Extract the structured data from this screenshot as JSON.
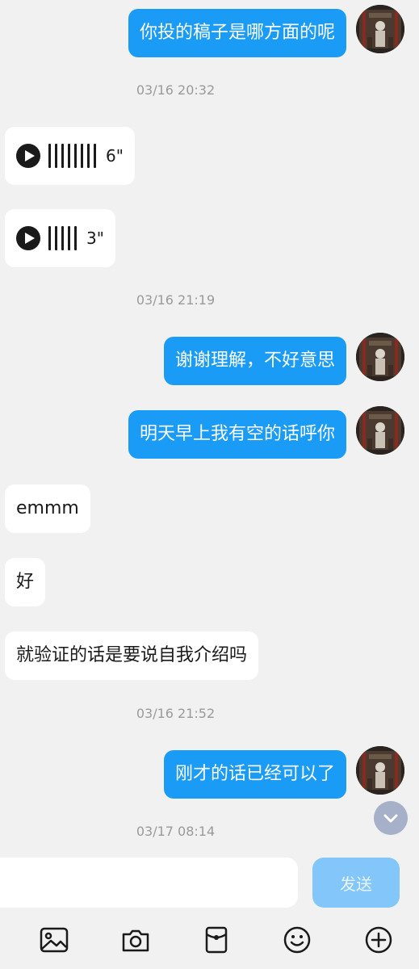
{
  "messages": [
    {
      "text": "你投的稿子是哪方面的呢"
    },
    {
      "duration": "6\""
    },
    {
      "duration": "3\""
    },
    {
      "text": "谢谢理解，不好意思"
    },
    {
      "text": "明天早上我有空的话呼你"
    },
    {
      "text": "emmm"
    },
    {
      "text": "好"
    },
    {
      "text": "就验证的话是要说自我介绍吗"
    },
    {
      "text": "刚才的话已经可以了"
    }
  ],
  "timestamps": [
    "03/16 20:32",
    "03/16 21:19",
    "03/16 21:52",
    "03/17 08:14"
  ],
  "input": {
    "placeholder": "",
    "send_label": "发送"
  },
  "toolbar": {
    "icons": [
      "image-icon",
      "camera-icon",
      "red-packet-icon",
      "emoji-icon",
      "plus-icon"
    ]
  },
  "colors": {
    "my_bubble": "#1a9bf5",
    "other_bubble": "#ffffff",
    "background": "#f1f1f1",
    "send_button": "#83c7fa"
  }
}
